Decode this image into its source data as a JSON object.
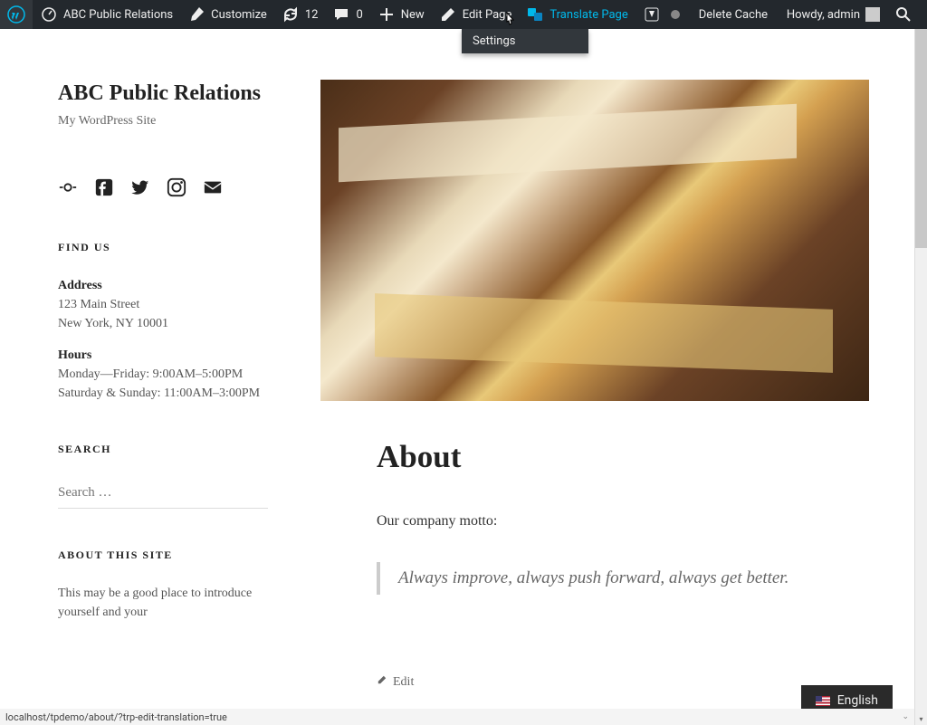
{
  "adminbar": {
    "site_name": "ABC Public Relations",
    "customize": "Customize",
    "updates_count": "12",
    "comments_count": "0",
    "new": "New",
    "edit_page": "Edit Page",
    "translate_page": "Translate Page",
    "delete_cache": "Delete Cache",
    "howdy": "Howdy, admin",
    "dropdown": {
      "settings": "Settings"
    }
  },
  "site": {
    "title": "ABC Public Relations",
    "tagline": "My WordPress Site"
  },
  "sidebar": {
    "find_us": {
      "heading": "FIND US",
      "address_label": "Address",
      "address_line1": "123 Main Street",
      "address_line2": "New York, NY 10001",
      "hours_label": "Hours",
      "hours_line1": "Monday—Friday: 9:00AM–5:00PM",
      "hours_line2": "Saturday & Sunday: 11:00AM–3:00PM"
    },
    "search": {
      "heading": "SEARCH",
      "placeholder": "Search …"
    },
    "about_site": {
      "heading": "ABOUT THIS SITE",
      "text": "This may be a good place to introduce yourself and your"
    }
  },
  "article": {
    "title": "About",
    "intro": "Our company motto:",
    "quote": "Always improve, always push forward, always get better.",
    "edit": "Edit"
  },
  "lang": {
    "label": "English"
  },
  "status": {
    "url": "localhost/tpdemo/about/?trp-edit-translation=true"
  }
}
